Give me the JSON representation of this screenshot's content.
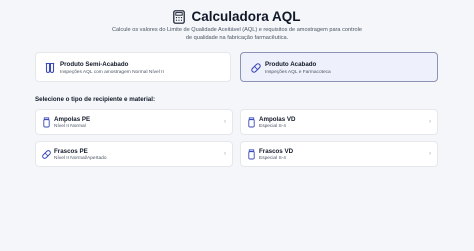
{
  "header": {
    "title": "Calculadora AQL",
    "subtitle": "Calcule os valores do Limite de Qualidade Aceitável (AQL) e requisitos de amostragem para controle de qualidade na fabricação farmacêutica."
  },
  "product_types": [
    {
      "title": "Produto Semi-Acabado",
      "desc": "Inspeções AQL com amostragem Normal Nível II",
      "icon": "test-tubes-icon",
      "selected": false
    },
    {
      "title": "Produto Acabado",
      "desc": "Inspeções AQL e Farmacoteca",
      "icon": "pill-icon",
      "selected": true
    }
  ],
  "section_label": "Selecione o tipo de recipiente e material:",
  "containers": [
    {
      "title": "Ampolas PE",
      "desc": "Nível II Normal",
      "icon": "vial-icon"
    },
    {
      "title": "Ampolas VD",
      "desc": "Especial S-4",
      "icon": "vial-icon"
    },
    {
      "title": "Frascos PE",
      "desc": "Nível II Normal/Apertado",
      "icon": "pill-icon"
    },
    {
      "title": "Frascos VD",
      "desc": "Especial S-4",
      "icon": "vial-icon"
    }
  ],
  "colors": {
    "accent": "#3b4bb8",
    "selected_bg": "#eef0fb"
  }
}
